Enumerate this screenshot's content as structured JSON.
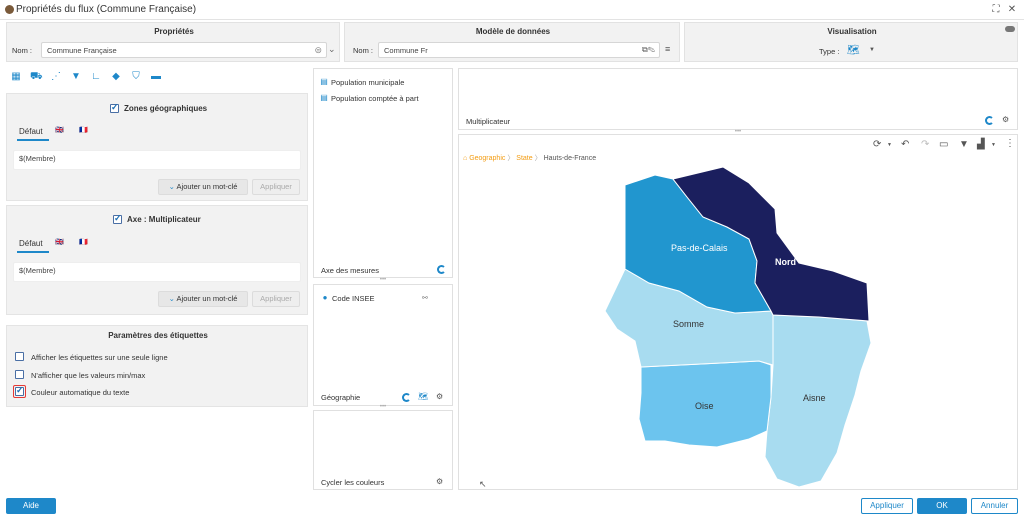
{
  "window": {
    "title": "Propriétés du flux (Commune Française)"
  },
  "proprietes": {
    "header": "Propriétés",
    "name_label": "Nom :",
    "name_value": "Commune Française"
  },
  "modele": {
    "header": "Modèle de données",
    "name_label": "Nom :",
    "name_value": "Commune Fr"
  },
  "visualisation": {
    "header": "Visualisation",
    "type_label": "Type :"
  },
  "zones": {
    "title": "Zones géographiques",
    "tab": "Défaut",
    "value": "$(Membre)",
    "add_keyword": "Ajouter un mot-clé",
    "apply": "Appliquer"
  },
  "axe": {
    "title": "Axe : Multiplicateur",
    "tab": "Défaut",
    "value": "$(Membre)",
    "add_keyword": "Ajouter un mot-clé",
    "apply": "Appliquer"
  },
  "labels_params": {
    "title": "Paramètres des étiquettes",
    "options": [
      {
        "label": "Afficher les étiquettes sur une seule ligne",
        "checked": false
      },
      {
        "label": "N'afficher que les valeurs min/max",
        "checked": false
      },
      {
        "label": "Couleur automatique du texte",
        "checked": true
      }
    ]
  },
  "measures": {
    "items": [
      "Population municipale",
      "Population comptée à part"
    ],
    "label": "Axe des mesures"
  },
  "geography": {
    "item": "Code INSEE",
    "label": "Géographie"
  },
  "cycle": {
    "label": "Cycler les couleurs"
  },
  "multiplicateur": {
    "label": "Multiplicateur"
  },
  "breadcrumb": {
    "items": [
      "Geographic",
      "State",
      "Hauts-de-France"
    ]
  },
  "map": {
    "regions": [
      {
        "name": "Pas-de-Calais",
        "color": "#2196cf"
      },
      {
        "name": "Nord",
        "color": "#1b1f5e"
      },
      {
        "name": "Somme",
        "color": "#a8dcf0"
      },
      {
        "name": "Oise",
        "color": "#6cc4ee"
      },
      {
        "name": "Aisne",
        "color": "#a8dcf0"
      }
    ]
  },
  "footer": {
    "help": "Aide",
    "apply": "Appliquer",
    "ok": "OK",
    "cancel": "Annuler"
  },
  "colors": {
    "accent": "#1e88c9",
    "accent_dark": "#1b1f5e",
    "checkbox_highlight": "#e53935"
  }
}
